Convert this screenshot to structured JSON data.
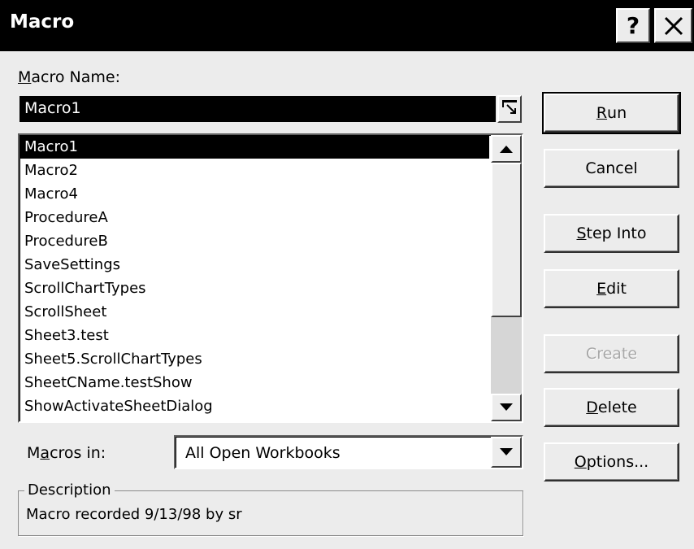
{
  "window": {
    "title": "Macro",
    "help_label": "?"
  },
  "macro_name": {
    "label_accel": "M",
    "label_rest": "acro Name:",
    "value": "Macro1"
  },
  "macros": [
    "Macro1",
    "Macro2",
    "Macro4",
    "ProcedureA",
    "ProcedureB",
    "SaveSettings",
    "ScrollChartTypes",
    "ScrollSheet",
    "Sheet3.test",
    "Sheet5.ScrollChartTypes",
    "SheetCName.testShow",
    "ShowActivateSheetDialog"
  ],
  "selected_macro": "Macro1",
  "macros_in": {
    "label_pre": "M",
    "label_accel": "a",
    "label_rest": "cros in:",
    "value": "All Open Workbooks"
  },
  "description": {
    "legend": "Description",
    "text": "Macro recorded 9/13/98 by sr"
  },
  "buttons": {
    "run": {
      "accel": "R",
      "rest": "un"
    },
    "cancel": {
      "label": "Cancel"
    },
    "step_into": {
      "accel": "S",
      "rest": "tep Into"
    },
    "edit": {
      "accel": "E",
      "rest": "dit"
    },
    "create": {
      "label": "Create"
    },
    "delete": {
      "accel": "D",
      "rest": "elete"
    },
    "options": {
      "accel": "O",
      "rest": "ptions..."
    }
  },
  "icons": {
    "close": "close-icon",
    "collapse": "collapse-dialog-icon",
    "scroll_up": "scroll-up-arrow-icon",
    "scroll_down": "scroll-down-arrow-icon",
    "dropdown": "dropdown-arrow-icon"
  }
}
